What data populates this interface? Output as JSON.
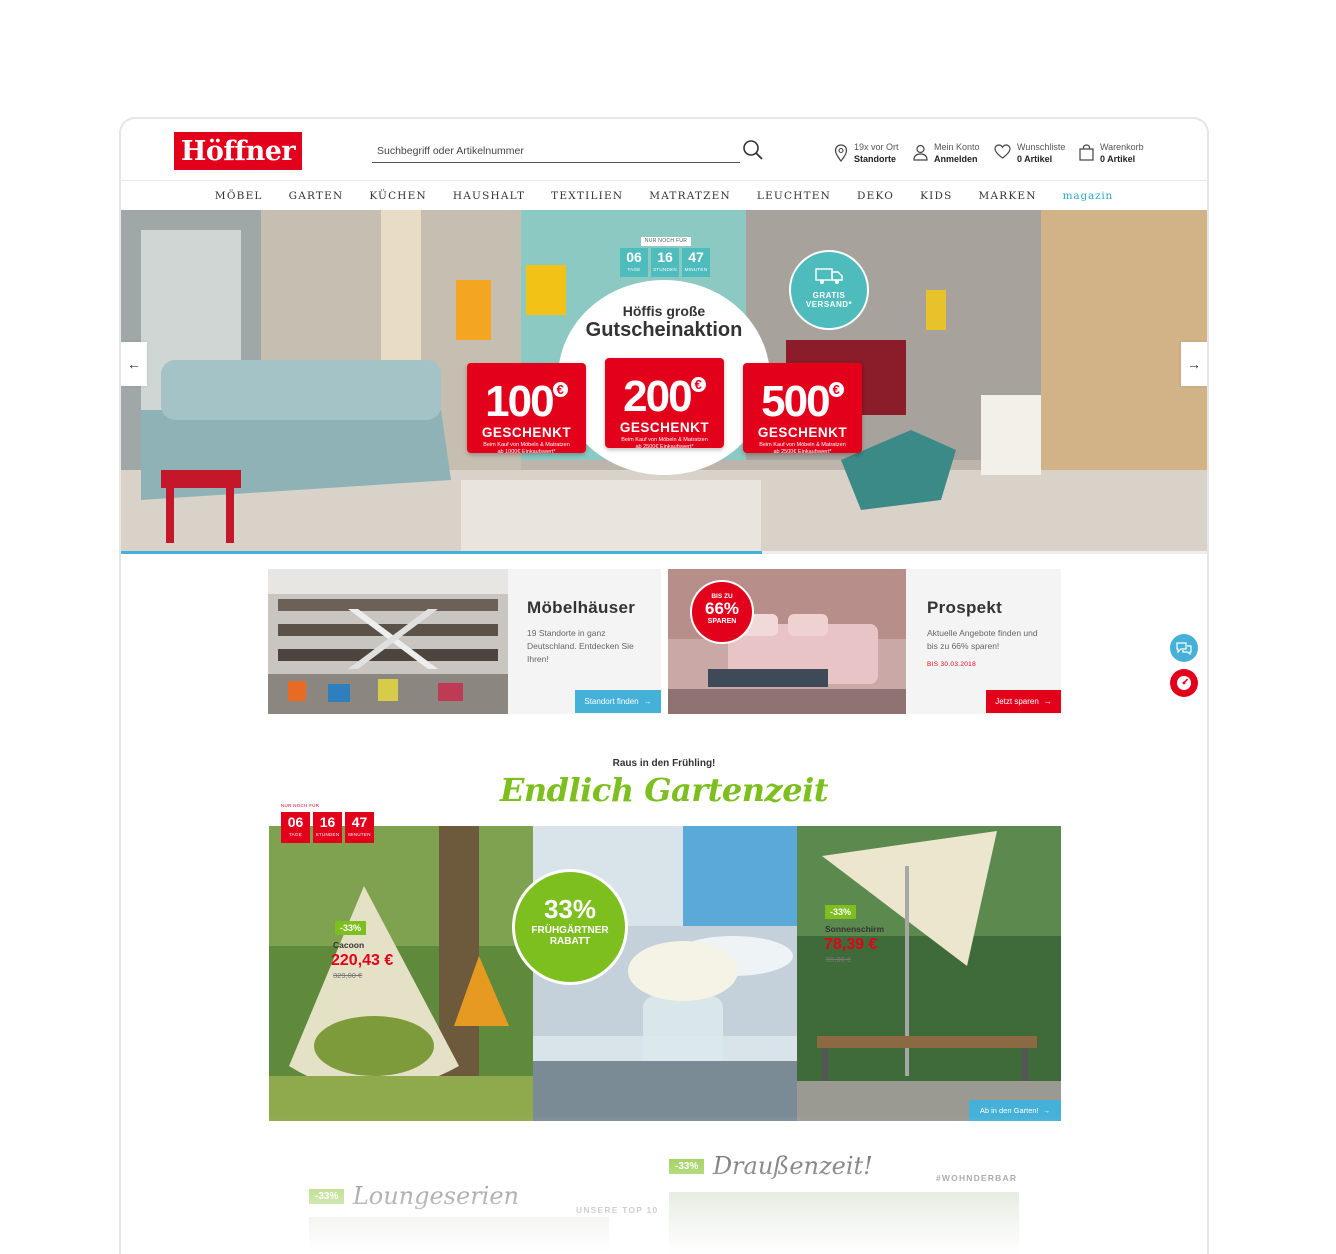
{
  "header": {
    "logo_text": "Höffner",
    "search_placeholder": "Suchbegriff oder Artikelnummer",
    "stores_line1": "19x vor Ort",
    "stores_line2": "Standorte",
    "account_line1": "Mein Konto",
    "account_line2": "Anmelden",
    "wishlist_line1": "Wunschliste",
    "wishlist_line2": "0 Artikel",
    "cart_line1": "Warenkorb",
    "cart_line2": "0 Artikel"
  },
  "nav": {
    "items": [
      "MÖBEL",
      "GARTEN",
      "KÜCHEN",
      "HAUSHALT",
      "TEXTILIEN",
      "MATRATZEN",
      "LEUCHTEN",
      "DEKO",
      "KIDS",
      "MARKEN",
      "magazin"
    ]
  },
  "hero": {
    "countdown_label": "NUR NOCH FÜR",
    "days": "06",
    "days_label": "TAGE",
    "hours": "16",
    "hours_label": "STUNDEN",
    "minutes": "47",
    "minutes_label": "MINUTEN",
    "headline1": "Höffis große",
    "headline2": "Gutscheinaktion",
    "shipping_line1": "GRATIS",
    "shipping_line2": "VERSAND*",
    "vouchers": [
      {
        "amount": "100",
        "currency": "€",
        "label": "GESCHENKT",
        "note1": "Beim Kauf von Möbeln & Matratzen",
        "note2": "ab 1000€ Einkaufswert*"
      },
      {
        "amount": "200",
        "currency": "€",
        "label": "GESCHENKT",
        "note1": "Beim Kauf von Möbeln & Matratzen",
        "note2": "ab 2500€ Einkaufswert*"
      },
      {
        "amount": "500",
        "currency": "€",
        "label": "GESCHENKT",
        "note1": "Beim Kauf von Möbeln & Matratzen",
        "note2": "ab 2500€ Einkaufswert*"
      }
    ],
    "slide_progress": 0.59
  },
  "tiles": {
    "stores": {
      "title": "Möbelhäuser",
      "text": "19 Standorte in ganz Deutschland. Entdecken Sie Ihren!",
      "button": "Standort finden"
    },
    "prospekt": {
      "title": "Prospekt",
      "text": "Aktuelle Angebote finden und bis zu 66% sparen!",
      "date": "BIS 30.03.2018",
      "button": "Jetzt sparen",
      "badge_line1": "BIS ZU",
      "badge_line2": "66%",
      "badge_line3": "SPAREN"
    }
  },
  "garden": {
    "pre_title": "Raus in den Frühling!",
    "title": "Endlich Gartenzeit",
    "countdown_label": "NUR NOCH FÜR",
    "days": "06",
    "days_label": "TAGE",
    "hours": "16",
    "hours_label": "STUNDEN",
    "minutes": "47",
    "minutes_label": "MINUTEN",
    "rabatt_pct": "33%",
    "rabatt_line1": "FRÜHGÄRTNER",
    "rabatt_line2": "RABATT",
    "product1": {
      "discount": "-33%",
      "name": "Cacoon",
      "price": "220,43 €",
      "old_price": "329,00 €"
    },
    "product2": {
      "discount": "-33%",
      "name": "Sonnenschirm",
      "price": "78,39 €",
      "old_price": "89,00 €"
    },
    "button": "Ab in den Garten!"
  },
  "teasers": {
    "left_tag": "-33%",
    "left_title": "Loungeserien",
    "left_sub": "UNSERE TOP 10",
    "right_tag": "-33%",
    "right_title": "Draußenzeit!",
    "right_sub": "#WOHNDERBAR"
  },
  "colors": {
    "brand_red": "#e3001b",
    "accent_blue": "#45b0d8",
    "garden_green": "#7cbf1e",
    "hero_teal": "#4ebcbd"
  }
}
